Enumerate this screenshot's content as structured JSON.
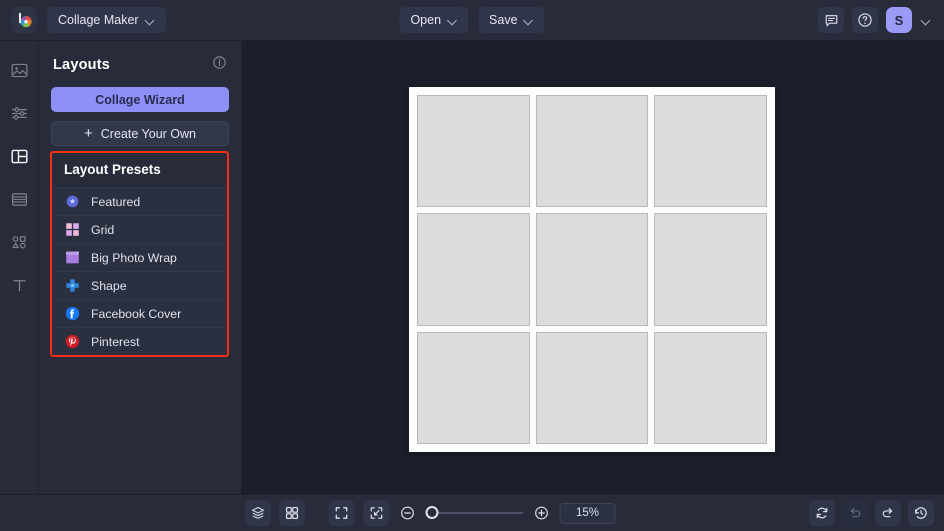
{
  "app": {
    "logo_icon": "befunky-logo-icon",
    "menu_label": "Collage Maker",
    "avatar_initial": "S"
  },
  "topbar": {
    "open_label": "Open",
    "save_label": "Save",
    "feedback_icon": "chat-bubble-icon",
    "help_icon": "question-circle-icon",
    "account_caret_icon": "chevron-down-icon"
  },
  "rail": {
    "items": [
      {
        "name": "image-manager",
        "icon": "image-icon",
        "active": false
      },
      {
        "name": "customize",
        "icon": "sliders-icon",
        "active": false
      },
      {
        "name": "layouts",
        "icon": "layouts-icon",
        "active": true
      },
      {
        "name": "textures",
        "icon": "layers-stack-icon",
        "active": false
      },
      {
        "name": "graphics",
        "icon": "shapes-icon",
        "active": false
      },
      {
        "name": "text",
        "icon": "text-t-icon",
        "active": false
      }
    ]
  },
  "panel": {
    "title": "Layouts",
    "info_icon": "info-circle-icon",
    "wizard_button": "Collage Wizard",
    "create_button": "Create Your Own",
    "create_icon": "plus-icon",
    "presets_title": "Layout Presets",
    "presets": [
      {
        "label": "Featured",
        "icon": "featured-wreath-icon",
        "color": "#6f7ce8"
      },
      {
        "label": "Grid",
        "icon": "grid-squares-icon",
        "color": "#f0b7d8"
      },
      {
        "label": "Big Photo Wrap",
        "icon": "big-photo-wrap-icon",
        "color": "#a77fe0"
      },
      {
        "label": "Shape",
        "icon": "shape-cross-icon",
        "color": "#2f88e0"
      },
      {
        "label": "Facebook Cover",
        "icon": "facebook-icon",
        "color": "#1877f2"
      },
      {
        "label": "Pinterest",
        "icon": "pinterest-icon",
        "color": "#cf1c26"
      }
    ],
    "highlight_color": "#f42d13"
  },
  "canvas": {
    "layout_name": "3x3-grid-collage",
    "rows": 3,
    "columns": 3,
    "cells": [
      "cell-1",
      "cell-2",
      "cell-3",
      "cell-4",
      "cell-5",
      "cell-6",
      "cell-7",
      "cell-8",
      "cell-9"
    ]
  },
  "bottombar": {
    "layers_icon": "layers-icon",
    "thumbnails_icon": "grid-view-icon",
    "fit_screen_icon": "fit-to-screen-icon",
    "fit_content_icon": "shrink-to-content-icon",
    "zoom_out_icon": "minus-circle-icon",
    "zoom_in_icon": "plus-circle-icon",
    "zoom_value": "15%",
    "refresh_icon": "refresh-icon",
    "undo_icon": "undo-icon",
    "redo_icon": "redo-icon",
    "history_icon": "history-clock-icon"
  }
}
